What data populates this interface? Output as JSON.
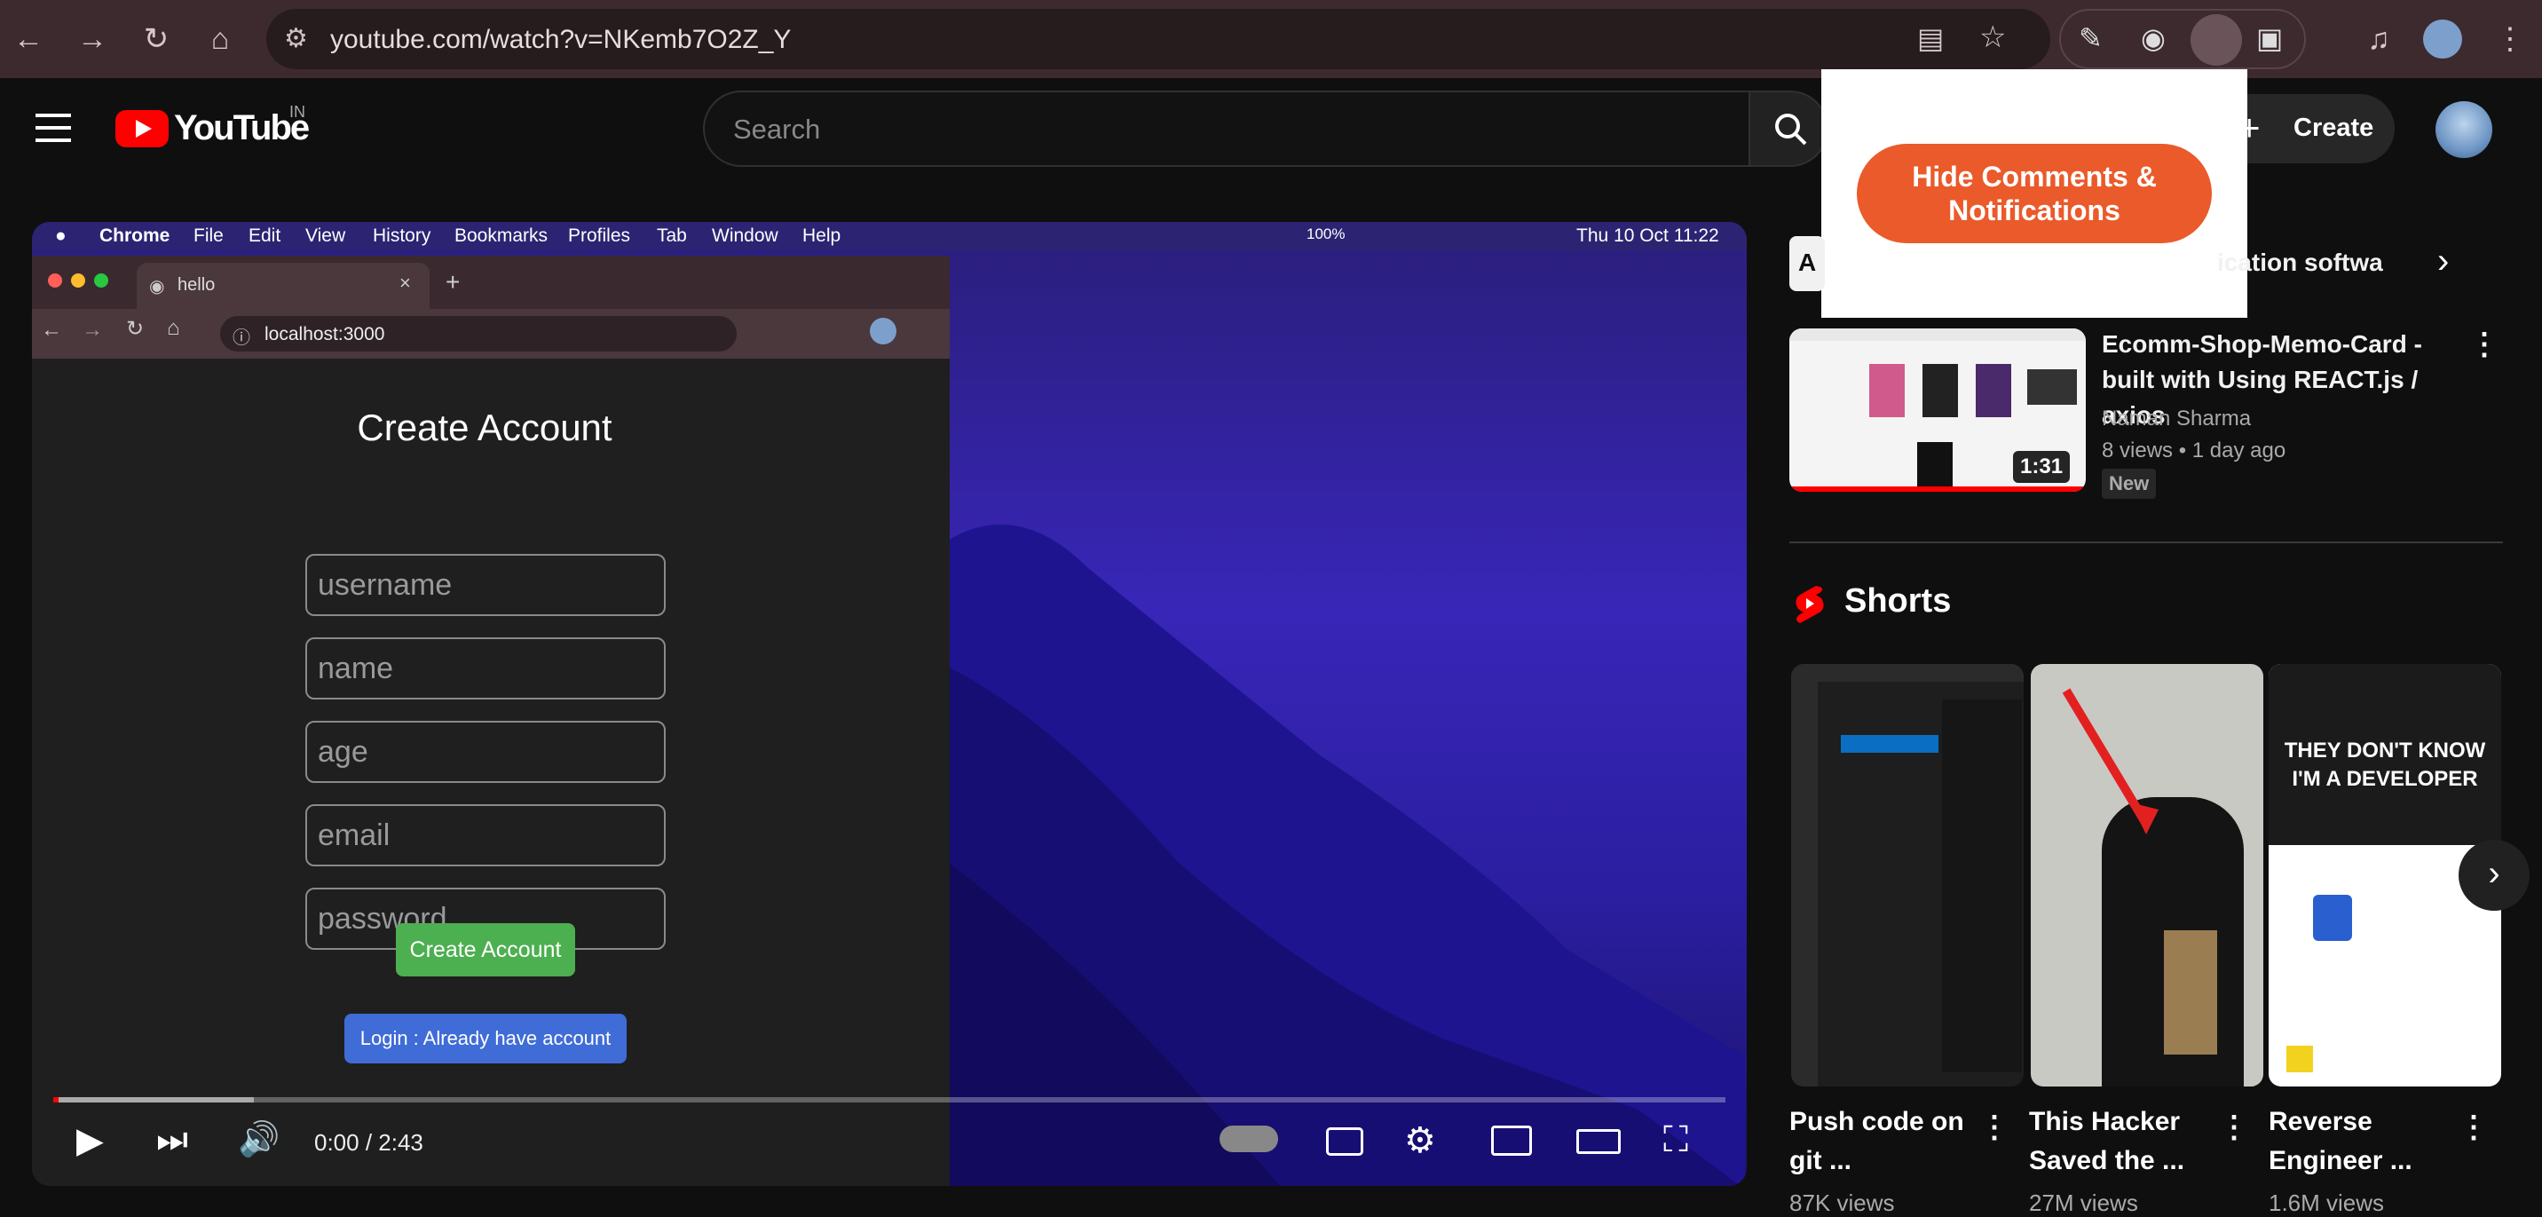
{
  "browser": {
    "url": "youtube.com/watch?v=NKemb7O2Z_Y"
  },
  "youtube": {
    "logo_text": "YouTube",
    "region": "IN",
    "search_placeholder": "Search",
    "create_label": "Create"
  },
  "popup": {
    "button_label": "Hide Comments & Notifications"
  },
  "video": {
    "mac_menu": [
      "Chrome",
      "File",
      "Edit",
      "View",
      "History",
      "Bookmarks",
      "Profiles",
      "Tab",
      "Window",
      "Help"
    ],
    "mac_status": {
      "battery": "100%",
      "datetime": "Thu 10 Oct  11:22"
    },
    "inner_tab_title": "hello",
    "inner_url": "localhost:3000",
    "form": {
      "title": "Create Account",
      "fields": [
        "username",
        "name",
        "age",
        "email",
        "password"
      ],
      "submit_label": "Create Account",
      "login_label": "Login : Already have account"
    },
    "time": "0:00 / 2:43",
    "progress_loaded": 0.12
  },
  "sidebar": {
    "chip_first": "A",
    "chip_text": "ication softwa",
    "video": {
      "title": "Ecomm-Shop-Memo-Card - built with Using REACT.js / axios",
      "channel": "Naman Sharma",
      "views": "8 views",
      "age": "1 day ago",
      "badge": "New",
      "duration": "1:31"
    },
    "shorts_heading": "Shorts",
    "shorts": [
      {
        "title": "Push code on git ...",
        "views": "87K views"
      },
      {
        "title": "This Hacker Saved the ...",
        "views": "27M views"
      },
      {
        "title": "Reverse Engineer ...",
        "views": "1.6M views",
        "thumb_text": "THEY DON'T KNOW I'M A DEVELOPER"
      }
    ]
  },
  "colors": {
    "youtube_red": "#ff0000",
    "popup_button": "#ea5a2a",
    "create_account_green": "#4caf50",
    "login_blue": "#3f6cd6"
  }
}
